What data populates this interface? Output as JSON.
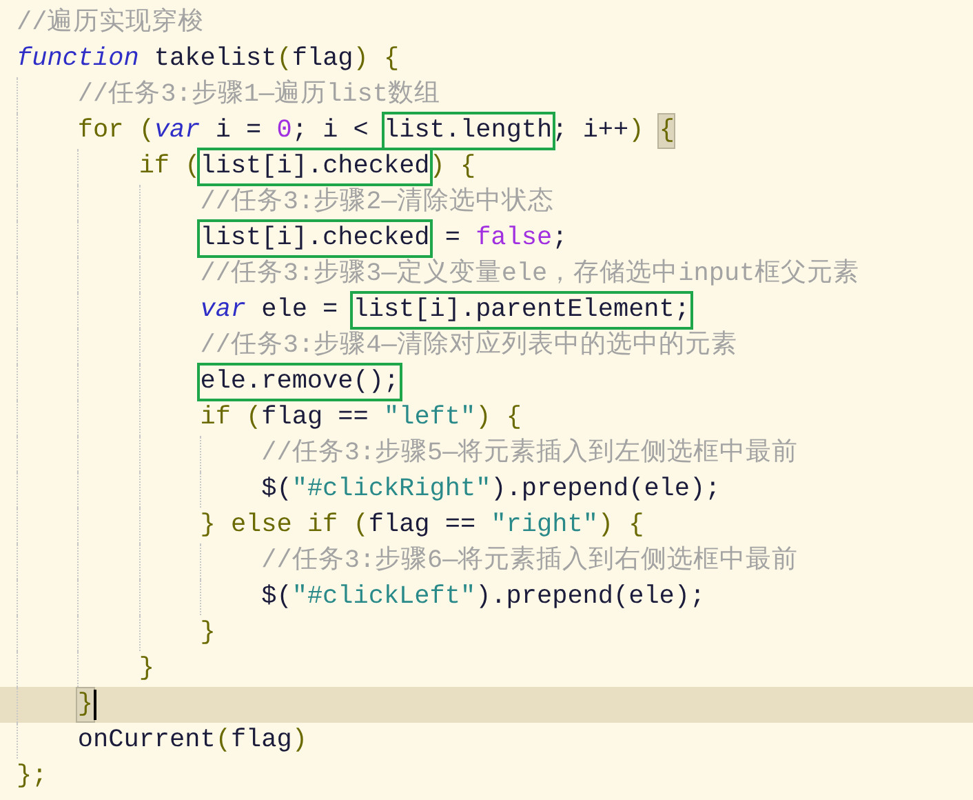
{
  "lines": [
    {
      "tokens": [
        {
          "text": "//遍历实现穿梭",
          "kind": "comment"
        }
      ]
    },
    {
      "tokens": [
        {
          "text": "function",
          "kind": "storage"
        },
        {
          "text": " takelist",
          "kind": "ident"
        },
        {
          "text": "(",
          "kind": "punct"
        },
        {
          "text": "flag",
          "kind": "ident"
        },
        {
          "text": ") {",
          "kind": "punct"
        }
      ],
      "children": [
        {
          "tokens": [
            {
              "text": "//任务3:步骤1—遍历list数组",
              "kind": "comment"
            }
          ]
        },
        {
          "tokens": [
            {
              "text": "for",
              "kind": "keyword"
            },
            {
              "text": " (",
              "kind": "punct"
            },
            {
              "text": "var",
              "kind": "storage"
            },
            {
              "text": " i = ",
              "kind": "ident"
            },
            {
              "text": "0",
              "kind": "number"
            },
            {
              "text": "; i < ",
              "kind": "ident"
            },
            {
              "text": "list.length",
              "kind": "ident",
              "boxed": true
            },
            {
              "text": "; i++",
              "kind": "ident"
            },
            {
              "text": ") ",
              "kind": "punct"
            },
            {
              "text": "{",
              "kind": "punct",
              "matched": true
            }
          ],
          "children": [
            {
              "tokens": [
                {
                  "text": "if",
                  "kind": "keyword"
                },
                {
                  "text": " (",
                  "kind": "punct"
                },
                {
                  "text": "list[i].checked",
                  "kind": "ident",
                  "boxed": true
                },
                {
                  "text": ") {",
                  "kind": "punct"
                }
              ],
              "children": [
                {
                  "tokens": [
                    {
                      "text": "//任务3:步骤2—清除选中状态",
                      "kind": "comment"
                    }
                  ]
                },
                {
                  "tokens": [
                    {
                      "text": "list[i].checked",
                      "kind": "ident",
                      "boxed": true
                    },
                    {
                      "text": " = ",
                      "kind": "ident"
                    },
                    {
                      "text": "false",
                      "kind": "number"
                    },
                    {
                      "text": ";",
                      "kind": "ident"
                    }
                  ]
                },
                {
                  "tokens": [
                    {
                      "text": "//任务3:步骤3—定义变量ele，存储选中input框父元素",
                      "kind": "comment"
                    }
                  ]
                },
                {
                  "tokens": [
                    {
                      "text": "var",
                      "kind": "storage"
                    },
                    {
                      "text": " ele = ",
                      "kind": "ident"
                    },
                    {
                      "text": "list[i].parentElement;",
                      "kind": "ident",
                      "boxed": true
                    }
                  ]
                },
                {
                  "tokens": [
                    {
                      "text": "//任务3:步骤4—清除对应列表中的选中的元素",
                      "kind": "comment"
                    }
                  ]
                },
                {
                  "tokens": [
                    {
                      "text": "ele.remove();",
                      "kind": "ident",
                      "boxed": true
                    }
                  ]
                },
                {
                  "tokens": [
                    {
                      "text": "if",
                      "kind": "keyword"
                    },
                    {
                      "text": " (",
                      "kind": "punct"
                    },
                    {
                      "text": "flag == ",
                      "kind": "ident"
                    },
                    {
                      "text": "\"left\"",
                      "kind": "string"
                    },
                    {
                      "text": ") {",
                      "kind": "punct"
                    }
                  ],
                  "children": [
                    {
                      "tokens": [
                        {
                          "text": "//任务3:步骤5—将元素插入到左侧选框中最前",
                          "kind": "comment"
                        }
                      ]
                    },
                    {
                      "tokens": [
                        {
                          "text": "$(",
                          "kind": "ident"
                        },
                        {
                          "text": "\"#clickRight\"",
                          "kind": "string"
                        },
                        {
                          "text": ").prepend(ele);",
                          "kind": "ident"
                        }
                      ]
                    }
                  ]
                },
                {
                  "tokens": [
                    {
                      "text": "} ",
                      "kind": "punct"
                    },
                    {
                      "text": "else if",
                      "kind": "keyword"
                    },
                    {
                      "text": " (",
                      "kind": "punct"
                    },
                    {
                      "text": "flag == ",
                      "kind": "ident"
                    },
                    {
                      "text": "\"right\"",
                      "kind": "string"
                    },
                    {
                      "text": ") {",
                      "kind": "punct"
                    }
                  ],
                  "children": [
                    {
                      "tokens": [
                        {
                          "text": "//任务3:步骤6—将元素插入到右侧选框中最前",
                          "kind": "comment"
                        }
                      ]
                    },
                    {
                      "tokens": [
                        {
                          "text": "$(",
                          "kind": "ident"
                        },
                        {
                          "text": "\"#clickLeft\"",
                          "kind": "string"
                        },
                        {
                          "text": ").prepend(ele);",
                          "kind": "ident"
                        }
                      ]
                    }
                  ]
                },
                {
                  "tokens": [
                    {
                      "text": "}",
                      "kind": "punct"
                    }
                  ]
                }
              ]
            },
            {
              "tokens": [
                {
                  "text": "}",
                  "kind": "punct"
                }
              ]
            }
          ]
        },
        {
          "tokens": [
            {
              "text": "}",
              "kind": "punct",
              "matched": true
            }
          ],
          "current": true
        },
        {
          "tokens": [
            {
              "text": "onCurrent",
              "kind": "ident"
            },
            {
              "text": "(",
              "kind": "punct"
            },
            {
              "text": "flag",
              "kind": "ident"
            },
            {
              "text": ")",
              "kind": "punct"
            }
          ]
        }
      ]
    },
    {
      "tokens": [
        {
          "text": "};",
          "kind": "punct"
        }
      ]
    }
  ]
}
